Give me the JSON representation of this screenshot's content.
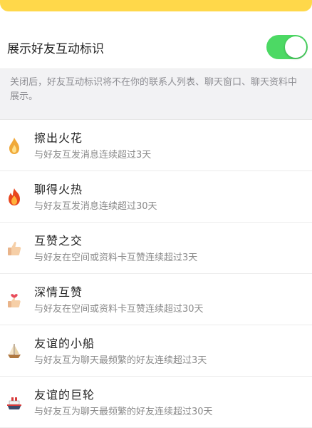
{
  "colors": {
    "accent_toggle": "#4cd964",
    "top_strip": "#ffd84a",
    "note_bg": "#f2f2f4"
  },
  "toggle_row": {
    "label": "展示好友互动标识",
    "enabled": true
  },
  "note": "关闭后，好友互动标识将不在你的联系人列表、聊天窗口、聊天资料中展示。",
  "items": [
    {
      "icon": "spark-flame-icon",
      "title": "擦出火花",
      "desc": "与好友互发消息连续超过3天"
    },
    {
      "icon": "fire-icon",
      "title": "聊得火热",
      "desc": "与好友互发消息连续超过30天"
    },
    {
      "icon": "thumbs-up-icon",
      "title": "互赞之交",
      "desc": "与好友在空间或资料卡互赞连续超过3天"
    },
    {
      "icon": "heart-thumbs-up-icon",
      "title": "深情互赞",
      "desc": "与好友在空间或资料卡互赞连续超过30天"
    },
    {
      "icon": "sailboat-icon",
      "title": "友谊的小船",
      "desc": "与好友互为聊天最频繁的好友连续超过3天"
    },
    {
      "icon": "ship-icon",
      "title": "友谊的巨轮",
      "desc": "与好友互为聊天最频繁的好友连续超过30天"
    }
  ]
}
